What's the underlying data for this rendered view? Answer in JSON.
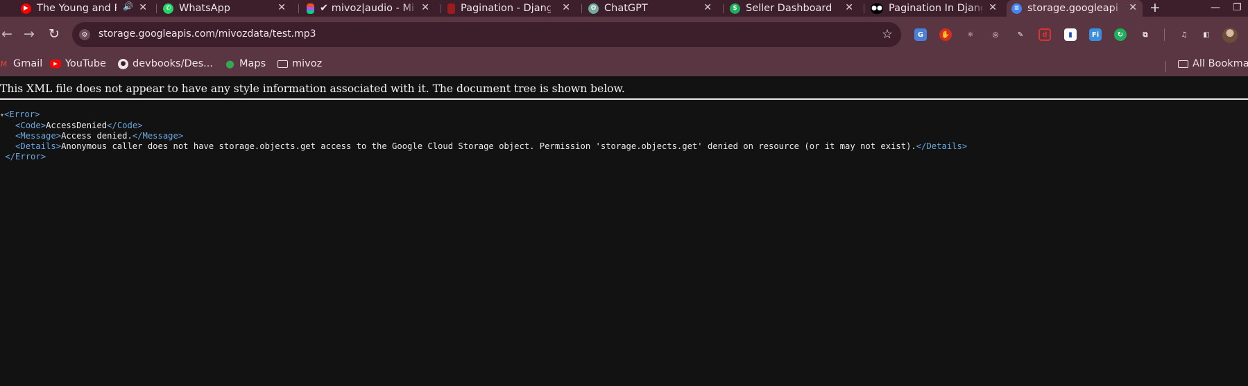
{
  "tabs": [
    {
      "title": "The Young and P",
      "favicon": "youtube-icon",
      "audio": true
    },
    {
      "title": "WhatsApp",
      "favicon": "whatsapp-icon"
    },
    {
      "title": "✔ mivoz|audio - Miv",
      "favicon": "figma-icon"
    },
    {
      "title": "Pagination - Djang",
      "favicon": "django-icon"
    },
    {
      "title": "ChatGPT",
      "favicon": "chatgpt-icon"
    },
    {
      "title": "Seller Dashboard",
      "favicon": "seller-icon"
    },
    {
      "title": "Pagination In Djang",
      "favicon": "medium-icon"
    },
    {
      "title": "storage.googleapis",
      "favicon": "globe-icon",
      "active": true
    }
  ],
  "toolbar": {
    "url": "storage.googleapis.com/mivozdata/test.mp3"
  },
  "bookmarks": {
    "items": [
      {
        "label": "Gmail",
        "icon": "gmail-icon"
      },
      {
        "label": "YouTube",
        "icon": "youtube-icon"
      },
      {
        "label": "devbooks/Des...",
        "icon": "github-icon"
      },
      {
        "label": "Maps",
        "icon": "maps-icon"
      },
      {
        "label": "mivoz",
        "icon": "folder-icon"
      }
    ],
    "all_label": "All Bookma"
  },
  "xml": {
    "info": "This XML file does not appear to have any style information associated with it. The document tree is shown below.",
    "root_tag": "Error",
    "code_tag": "Code",
    "code_value": "AccessDenied",
    "message_tag": "Message",
    "message_value": "Access denied.",
    "details_tag": "Details",
    "details_value": "Anonymous caller does not have storage.objects.get access to the Google Cloud Storage object. Permission 'storage.objects.get' denied on resource (or it may not exist)."
  },
  "colors": {
    "tabstrip": "#3c1f2b",
    "toolbar": "#5a3542",
    "xml_tag": "#6aa7e0",
    "page_bg": "#121212"
  }
}
